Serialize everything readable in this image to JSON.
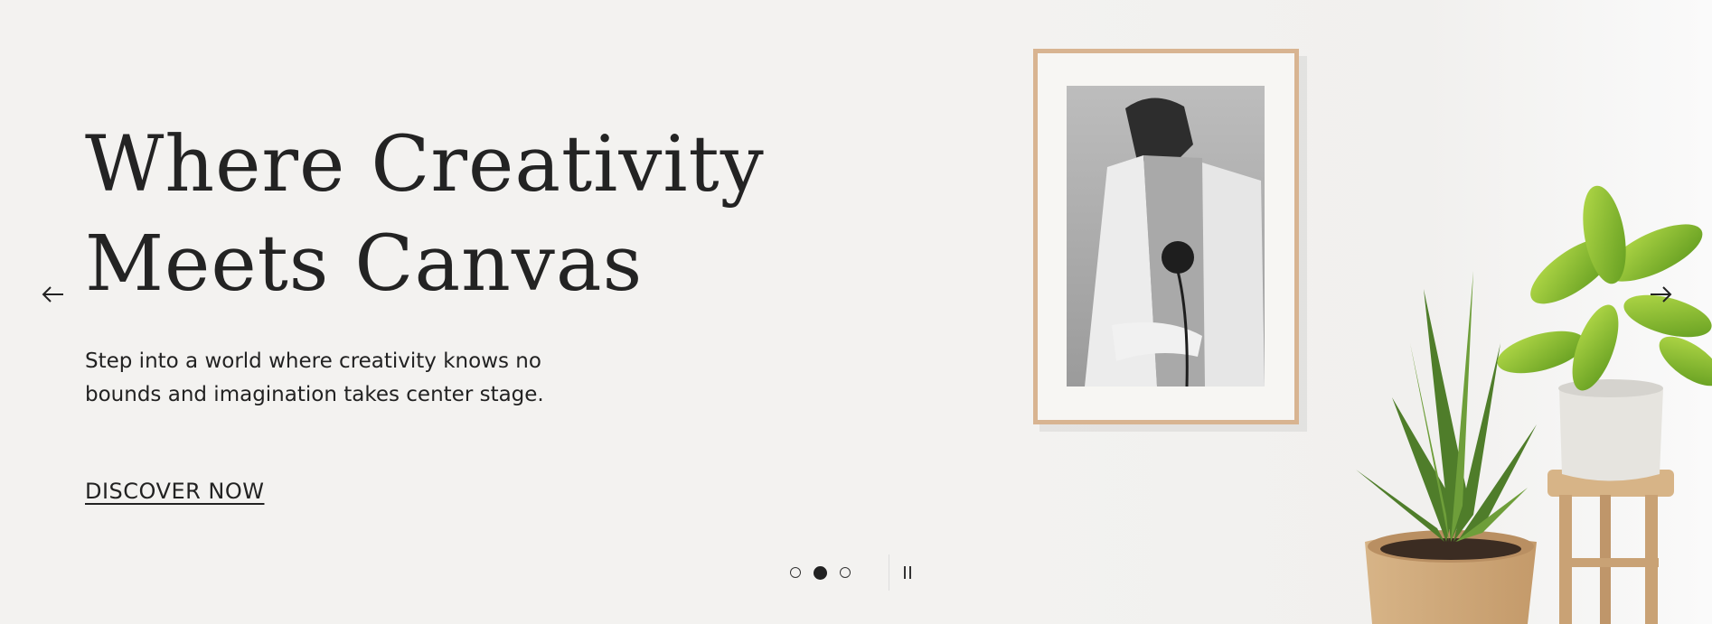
{
  "hero": {
    "headline_line1": "Where Creativity",
    "headline_line2": "Meets Canvas",
    "subtext": "Step into a world where creativity knows no bounds and imagination takes center stage.",
    "cta_label": "DISCOVER NOW"
  },
  "navigation": {
    "prev_icon": "arrow-left-icon",
    "next_icon": "arrow-right-icon"
  },
  "slideshow": {
    "slides_total": 3,
    "active_slide": 2,
    "pause_icon": "pause-icon"
  },
  "colors": {
    "background": "#f3f2f0",
    "text": "#222222",
    "frame_wood": "#d8b491"
  }
}
